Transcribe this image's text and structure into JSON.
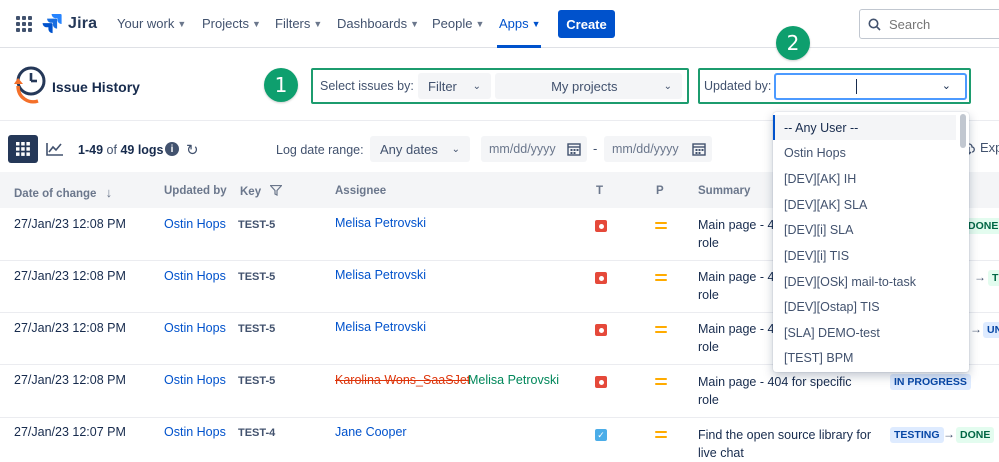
{
  "nav": {
    "logo": "Jira",
    "items": [
      {
        "label": "Your work"
      },
      {
        "label": "Projects"
      },
      {
        "label": "Filters"
      },
      {
        "label": "Dashboards"
      },
      {
        "label": "People"
      },
      {
        "label": "Apps"
      }
    ],
    "active_item": "Apps",
    "create_label": "Create",
    "search_placeholder": "Search"
  },
  "header": {
    "title": "Issue History",
    "badge1": "1",
    "badge2": "2",
    "select_issues_label": "Select issues by:",
    "filter_type": "Filter",
    "filter_value": "My projects",
    "updated_by_label": "Updated by:",
    "updated_by_value": ""
  },
  "toolbar": {
    "logs_range": "1-49",
    "logs_of": "of",
    "logs_total": "49 logs",
    "date_range_label": "Log date range:",
    "date_range_value": "Any dates",
    "date_from_placeholder": "mm/dd/yyyy",
    "date_separator": "-",
    "date_to_placeholder": "mm/dd/yyyy",
    "export_label": "Exp"
  },
  "table": {
    "columns": {
      "date": "Date of change",
      "updated_by": "Updated by",
      "key": "Key",
      "assignee": "Assignee",
      "type": "T",
      "priority": "P",
      "summary": "Summary"
    },
    "rows": [
      {
        "date": "27/Jan/23 12:08 PM",
        "updated_by": "Ostin Hops",
        "key": "TEST-5",
        "assignee": "Melisa Petrovski",
        "type": "bug",
        "summary": "Main page - 4",
        "summary2": "role",
        "status_to": "DONE"
      },
      {
        "date": "27/Jan/23 12:08 PM",
        "updated_by": "Ostin Hops",
        "key": "TEST-5",
        "assignee": "Melisa Petrovski",
        "type": "bug",
        "summary": "Main page - 4",
        "summary2": "role",
        "status_to": "T"
      },
      {
        "date": "27/Jan/23 12:08 PM",
        "updated_by": "Ostin Hops",
        "key": "TEST-5",
        "assignee": "Melisa Petrovski",
        "type": "bug",
        "summary": "Main page - 4",
        "summary2": "role",
        "status_to": "UN"
      },
      {
        "date": "27/Jan/23 12:08 PM",
        "updated_by": "Ostin Hops",
        "key": "TEST-5",
        "assignee_old": "Karolina Wons_SaaSJet",
        "assignee": "Melisa Petrovski",
        "type": "bug",
        "summary": "Main page - 404 for specific",
        "summary2": "role",
        "status": "IN PROGRESS"
      },
      {
        "date": "27/Jan/23 12:07 PM",
        "updated_by": "Ostin Hops",
        "key": "TEST-4",
        "assignee": "Jane Cooper",
        "type": "task",
        "summary": "Find the open source library for",
        "summary2": "live chat",
        "status_from": "TESTING",
        "status_to": "DONE"
      }
    ]
  },
  "dropdown": {
    "options": [
      "-- Any User --",
      "Ostin Hops",
      "[DEV][AK] IH",
      "[DEV][AK] SLA",
      "[DEV][i] SLA",
      "[DEV][i] TIS",
      "[DEV][OSk] mail-to-task",
      "[DEV][Ostap] TIS",
      "[SLA] DEMO-test",
      "[TEST] BPM"
    ]
  },
  "colors": {
    "accent": "#0052CC",
    "badge": "#0E9F6E",
    "frame": "#1C9C6E"
  }
}
